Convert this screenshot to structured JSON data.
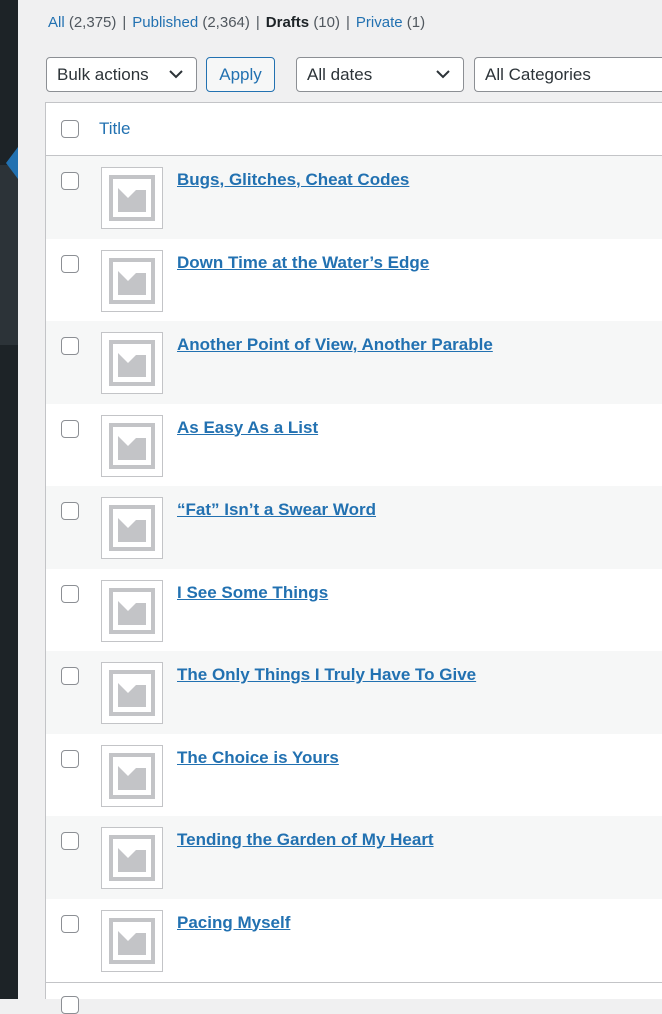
{
  "views": {
    "all_label": "All",
    "all_count": "(2,375)",
    "published_label": "Published",
    "published_count": "(2,364)",
    "drafts_label": "Drafts",
    "drafts_count": "(10)",
    "private_label": "Private",
    "private_count": "(1)",
    "separator": "|"
  },
  "filters": {
    "bulk_actions": "Bulk actions",
    "apply": "Apply",
    "dates": "All dates",
    "categories": "All Categories"
  },
  "table": {
    "column_title": "Title",
    "rows": [
      {
        "title": "Bugs, Glitches, Cheat Codes"
      },
      {
        "title": "Down Time at the Water’s Edge"
      },
      {
        "title": "Another Point of View, Another Parable"
      },
      {
        "title": "As Easy As a List"
      },
      {
        "title": "“Fat” Isn’t a Swear Word"
      },
      {
        "title": "I See Some Things"
      },
      {
        "title": "The Only Things I Truly Have To Give"
      },
      {
        "title": "The Choice is Yours"
      },
      {
        "title": "Tending the Garden of My Heart"
      },
      {
        "title": "Pacing Myself"
      }
    ]
  },
  "colors": {
    "link": "#2271b1",
    "admin_menu": "#1d2327",
    "row_alt": "#f6f7f7"
  },
  "icons": {
    "chevron": "chevron-down-icon",
    "thumbnail": "image-placeholder-icon"
  }
}
